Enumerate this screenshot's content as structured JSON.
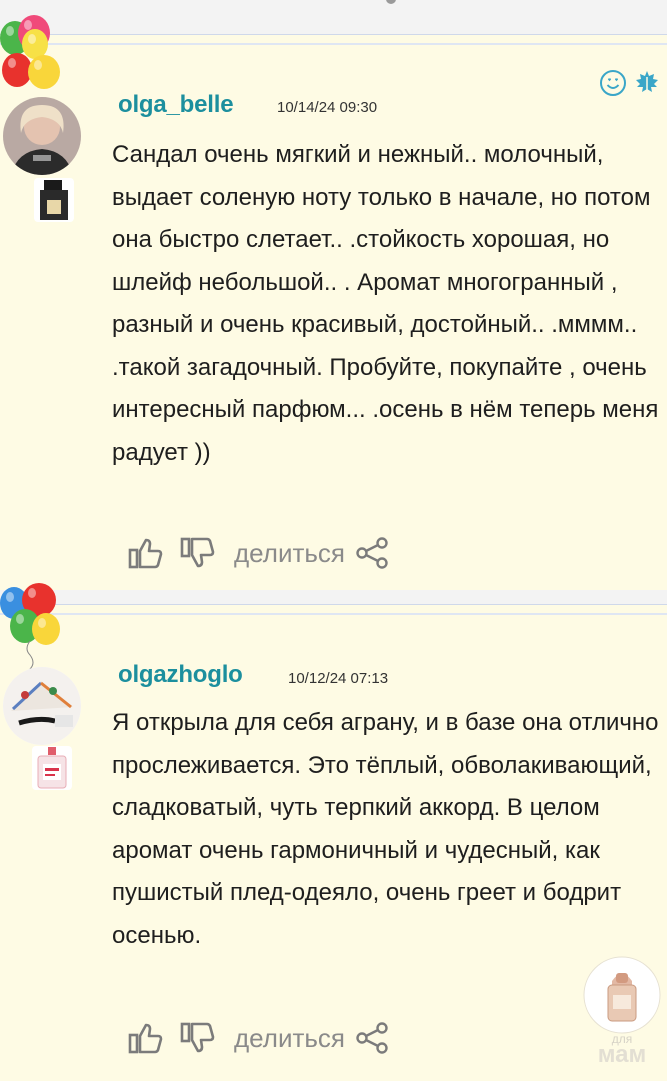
{
  "reviews": [
    {
      "username": "olga_belle",
      "datetime": "10/14/24 09:30",
      "text": "Сандал очень мягкий и нежный.. молочный, выдает соленую ноту только в начале, но потом она быстро слетает.. .стойкость хорошая, но шлейф небольшой.. . Аромат многогранный , разный и очень красивый, достойный.. .мммм.. .такой загадочный. Пробуйте, покупайте , очень интересный парфюм... .осень в нём теперь меня радует ))",
      "like_icon": "thumbs-up-icon",
      "dislike_icon": "thumbs-down-icon",
      "share_label": "делиться",
      "share_icon": "share-icon"
    },
    {
      "username": "olgazhoglo",
      "datetime": "10/12/24 07:13",
      "text": "Я открыла для себя аграну, и в базе она отлично прослеживается. Это тёплый, обволакивающий, сладковатый, чуть терпкий аккорд. В целом аромат очень гармоничный и чудесный, как пушистый плед-одеяло, очень греет и бодрит осенью.",
      "like_icon": "thumbs-up-icon",
      "dislike_icon": "thumbs-down-icon",
      "share_label": "делиться",
      "share_icon": "share-icon"
    }
  ],
  "watermark": {
    "line1": "для",
    "line2": "мам"
  },
  "colors": {
    "card_bg": "#fefbe4",
    "username": "#1c8f9e",
    "text": "#1e1e1e",
    "muted": "#8a8a8a"
  }
}
